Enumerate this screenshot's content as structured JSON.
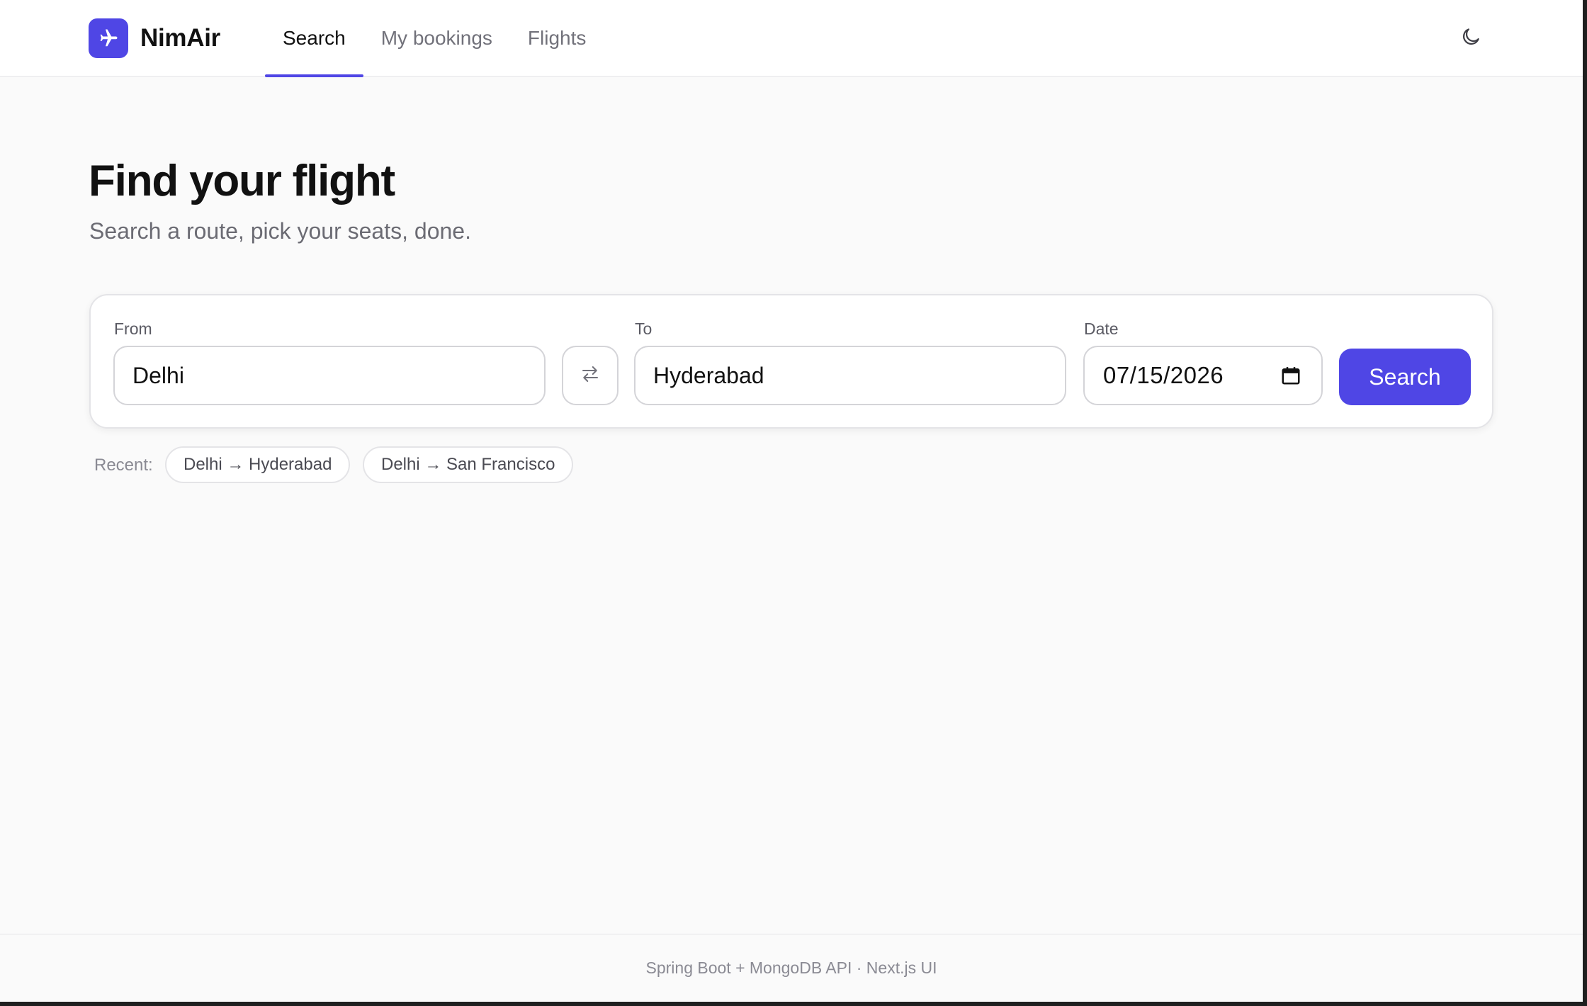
{
  "brand": {
    "name": "NimAir",
    "logo_icon": "plane-icon",
    "accent_color": "#4f46e5"
  },
  "nav": {
    "tabs": [
      {
        "label": "Search",
        "active": true
      },
      {
        "label": "My bookings",
        "active": false
      },
      {
        "label": "Flights",
        "active": false
      }
    ],
    "theme_toggle_icon": "moon-icon"
  },
  "hero": {
    "title": "Find your flight",
    "subtitle": "Search a route, pick your seats, done."
  },
  "search_form": {
    "from_label": "From",
    "from_value": "Delhi",
    "swap_icon": "swap-arrows-icon",
    "to_label": "To",
    "to_value": "Hyderabad",
    "date_label": "Date",
    "date_value": "07/15/2026",
    "calendar_icon": "calendar-icon",
    "search_button_label": "Search"
  },
  "recent": {
    "label": "Recent:",
    "items": [
      {
        "label": "Delhi → Hyderabad"
      },
      {
        "label": "Delhi → San Francisco"
      }
    ]
  },
  "footer": {
    "text": "Spring Boot + MongoDB API · Next.js UI"
  }
}
